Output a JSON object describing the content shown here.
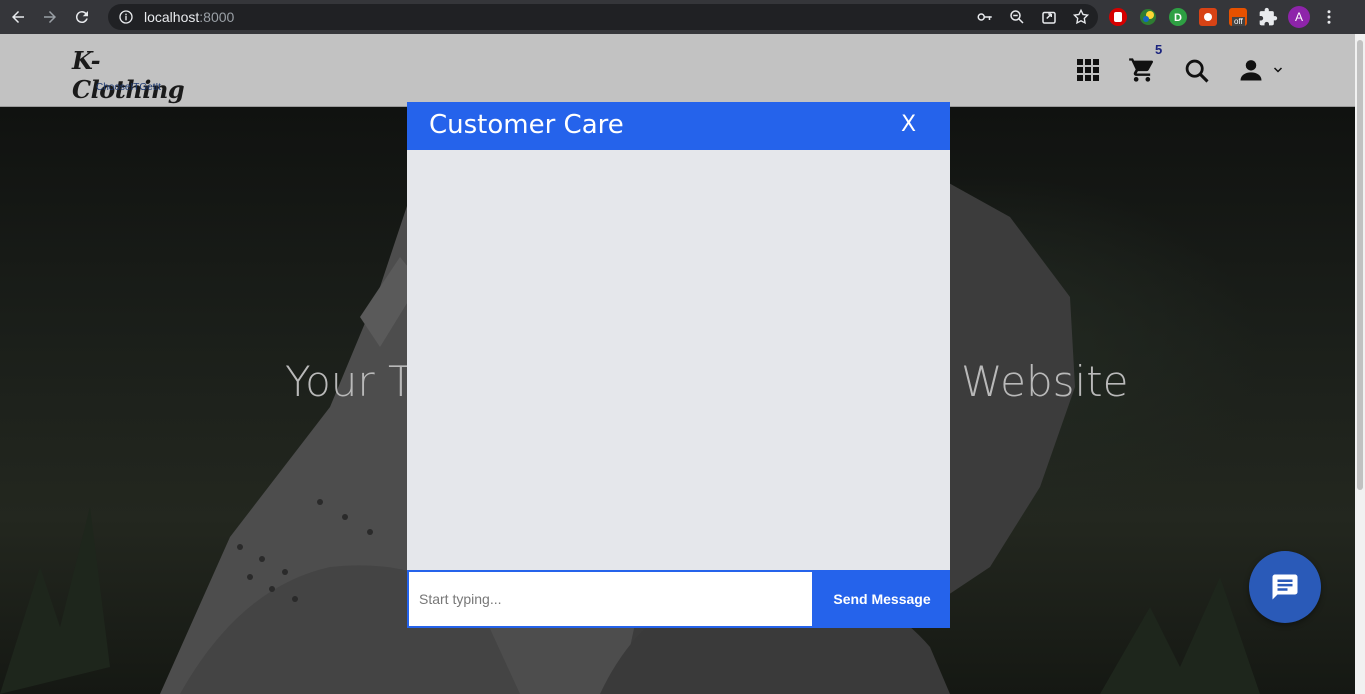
{
  "browser": {
    "url_host": "localhost",
    "url_port": ":8000",
    "profile_initial": "A",
    "extension_badge": "off"
  },
  "site": {
    "logo_title": "K-Clothing",
    "logo_tagline": "ChooseITGetIt",
    "cart_count": "5"
  },
  "hero": {
    "text": "Your T                                         Website"
  },
  "chat": {
    "title": "Customer Care",
    "close_label": "X",
    "input_placeholder": "Start typing...",
    "send_label": "Send Message"
  },
  "colors": {
    "accent": "#2563eb",
    "fab": "#2a5ab8"
  }
}
